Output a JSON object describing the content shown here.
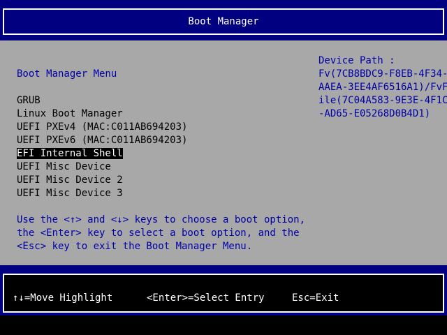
{
  "header": {
    "title": "Boot Manager"
  },
  "menu": {
    "title": "Boot Manager Menu",
    "items": [
      {
        "label": "GRUB"
      },
      {
        "label": "Linux Boot Manager"
      },
      {
        "label": "UEFI PXEv4 (MAC:C011AB694203)"
      },
      {
        "label": "UEFI PXEv6 (MAC:C011AB694203)"
      },
      {
        "label": "EFI Internal Shell"
      },
      {
        "label": "UEFI Misc Device"
      },
      {
        "label": "UEFI Misc Device 2"
      },
      {
        "label": "UEFI Misc Device 3"
      }
    ],
    "selected_label": "EFI Internal Shell"
  },
  "help": {
    "line1": "Use the <↑> and <↓> keys to choose a boot option,",
    "line2": "the <Enter> key to select a boot option, and the",
    "line3": "<Esc> key to exit the Boot Manager Menu."
  },
  "device_path": {
    "label": "Device Path :",
    "lines": [
      "Fv(7CB8BDC9-F8EB-4F34-",
      "AAEA-3EE4AF6516A1)/FvF",
      "ile(7C04A583-9E3E-4F1C",
      "-AD65-E05268D0B4D1)"
    ]
  },
  "footer": {
    "move": "↑↓=Move Highlight",
    "select": "<Enter>=Select Entry",
    "exit": "Esc=Exit"
  },
  "colors": {
    "header_bg": "#000080",
    "panel_bg": "#a8a8a8",
    "accent_text": "#0000a8",
    "highlight_bg": "#000000",
    "highlight_fg": "#ffffff"
  }
}
